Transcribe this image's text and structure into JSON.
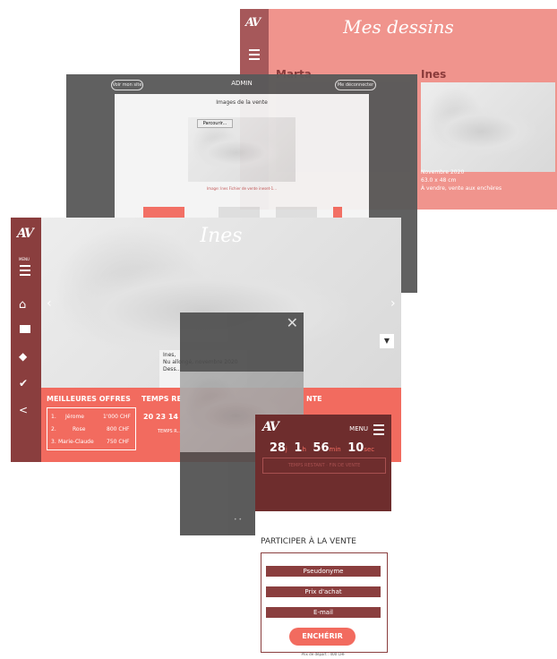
{
  "dessins": {
    "logo": "AV",
    "title": "Mes dessins",
    "artists": [
      "Marta",
      "Ines"
    ],
    "caption_lines": [
      "Novembre 2020",
      "63.0 x 48 cm",
      "À vendre, vente aux enchères"
    ]
  },
  "admin": {
    "left_button": "Voir mon site",
    "title": "ADMIN",
    "right_button": "Me déconnecter",
    "section_title": "Images de la vente",
    "browse_label": "Parcourir...",
    "image_caption": "Image: Ines Fichier de vente ineset-1..."
  },
  "ines": {
    "logo": "AV",
    "menu_label": "MENU",
    "title": "Ines",
    "prev_arrow": "‹",
    "next_arrow": "›",
    "caption": "Ines,\nNu allongé, novembre 2020\nDess...",
    "best_offers_title": "MEILLEURES OFFRES",
    "remaining_title": "TEMPS RE",
    "sale_title": "NTE",
    "offers": [
      {
        "rank": "1.",
        "name": "Jérome",
        "amount": "1'000 CHF"
      },
      {
        "rank": "2.",
        "name": "Rose",
        "amount": "800 CHF"
      },
      {
        "rank": "3.",
        "name": "Marie-Claude",
        "amount": "750 CHF"
      }
    ],
    "timer": "20 23 14",
    "timer_sub": "TEMPS R...",
    "sidebar_icons": [
      "home-icon",
      "gallery-icon",
      "tag-icon",
      "check-icon",
      "share-icon"
    ]
  },
  "modal": {
    "close": "✕",
    "dots": "• •"
  },
  "mobile": {
    "logo": "AV",
    "menu_label": "MENU",
    "countdown": {
      "days": "28",
      "d_unit": "j",
      "hours": "1",
      "h_unit": "h",
      "minutes": "56",
      "m_unit": "min",
      "seconds": "10",
      "s_unit": "sec"
    },
    "faded_text": "TEMPS RESTANT · FIN DE VENTE",
    "participate": "PARTICIPER À LA VENTE",
    "fields": [
      "Pseudonyme",
      "Prix d'achat",
      "E-mail"
    ],
    "bid_button": "ENCHÉRIR",
    "start_price": "Prix de départ : 400 CHF"
  }
}
